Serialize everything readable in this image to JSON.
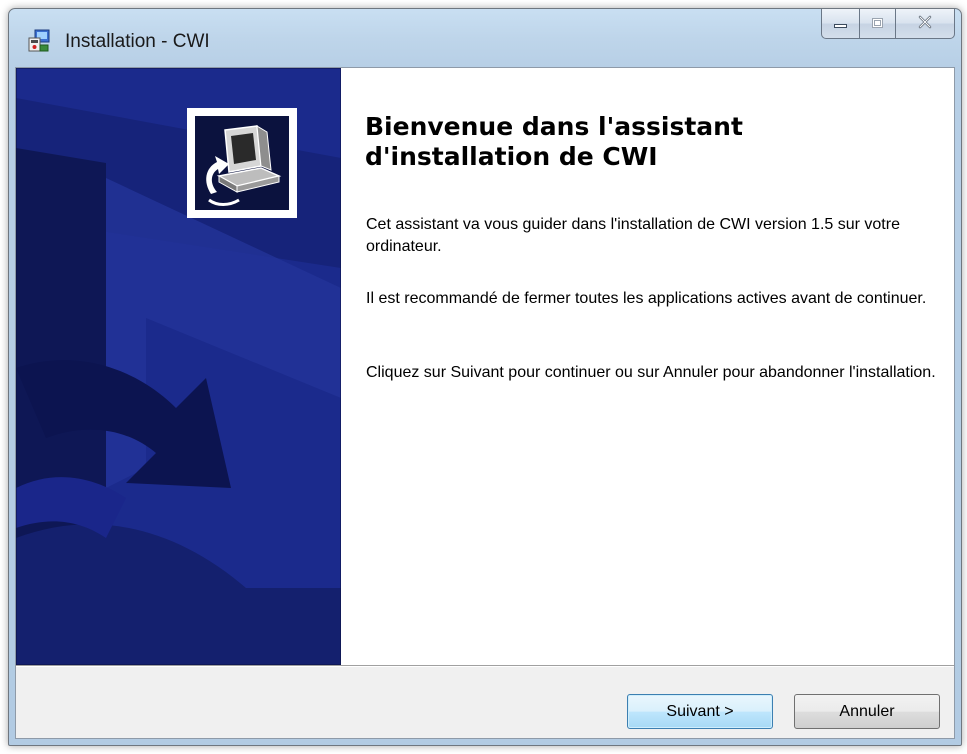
{
  "window": {
    "title": "Installation - CWI",
    "icon": "installer-icon",
    "controls": [
      "minimize-icon",
      "maximize-icon",
      "close-icon"
    ]
  },
  "side_panel": {
    "logo": "setup-computer-icon"
  },
  "content": {
    "heading_line1": "Bienvenue dans l'assistant",
    "heading_line2": "d'installation de CWI",
    "paragraph1": "Cet assistant va vous guider dans l'installation de CWI version 1.5 sur votre ordinateur.",
    "paragraph2": "Il est recommandé de fermer toutes les applications actives avant de continuer.",
    "paragraph3": "Cliquez sur Suivant pour continuer ou sur Annuler pour abandonner l'installation."
  },
  "buttons": {
    "next_label": "Suivant >",
    "cancel_label": "Annuler"
  },
  "colors": {
    "side_panel": "#1b2a8c",
    "next_button_border": "#3c7fb1"
  }
}
